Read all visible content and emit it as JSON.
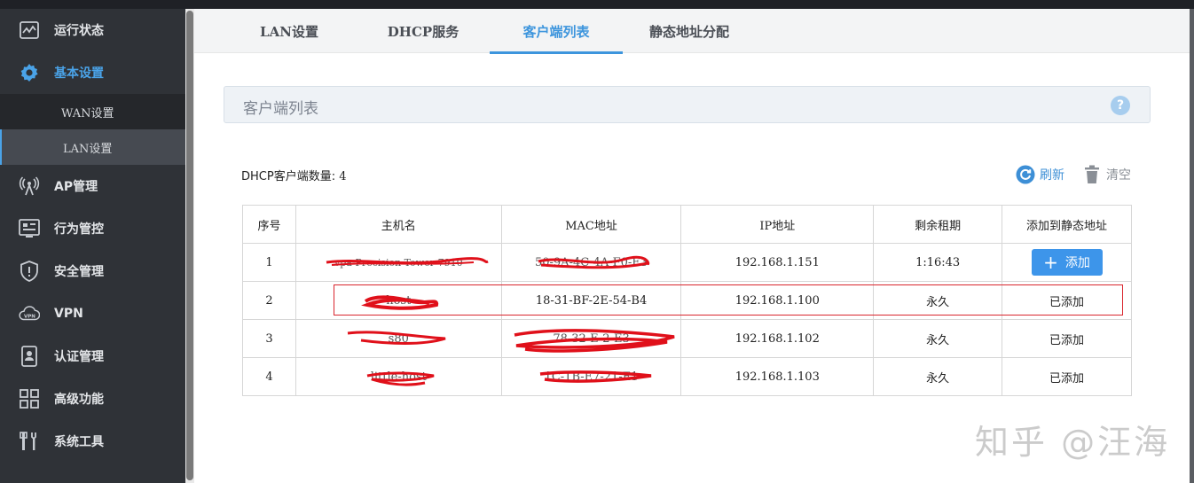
{
  "sidebar": {
    "items": [
      {
        "label": "运行状态",
        "icon": "monitor-chart-icon"
      },
      {
        "label": "基本设置",
        "icon": "gear-icon"
      },
      {
        "label": "AP管理",
        "icon": "antenna-icon"
      },
      {
        "label": "行为管控",
        "icon": "control-panel-icon"
      },
      {
        "label": "安全管理",
        "icon": "shield-icon"
      },
      {
        "label": "VPN",
        "icon": "vpn-cloud-icon"
      },
      {
        "label": "认证管理",
        "icon": "id-badge-icon"
      },
      {
        "label": "高级功能",
        "icon": "grid-apps-icon"
      },
      {
        "label": "系统工具",
        "icon": "tools-icon"
      }
    ],
    "subitems": [
      {
        "label": "WAN设置"
      },
      {
        "label": "LAN设置"
      }
    ]
  },
  "tabs": [
    {
      "label": "LAN设置"
    },
    {
      "label": "DHCP服务"
    },
    {
      "label": "客户端列表"
    },
    {
      "label": "静态地址分配"
    }
  ],
  "panel": {
    "title": "客户端列表",
    "help_glyph": "?"
  },
  "count": {
    "label": "DHCP客户端数量:",
    "value": "4"
  },
  "actions": {
    "refresh": "刷新",
    "clear": "清空"
  },
  "table": {
    "headers": [
      "序号",
      "主机名",
      "MAC地址",
      "IP地址",
      "剩余租期",
      "添加到静态地址"
    ],
    "rows": [
      {
        "index": "1",
        "hostname": "vpa-Precision-Tower-7910",
        "mac": "50-9A-4C-4A-F0-E3",
        "ip": "192.168.1.151",
        "lease": "1:16:43",
        "status": "添加"
      },
      {
        "index": "2",
        "hostname": "host",
        "mac": "18-31-BF-2E-54-B4",
        "ip": "192.168.1.100",
        "lease": "永久",
        "status": "已添加"
      },
      {
        "index": "3",
        "hostname": "s80",
        "mac": "78-32-E-2-E3",
        "ip": "192.168.1.102",
        "lease": "永久",
        "status": "已添加"
      },
      {
        "index": "4",
        "hostname": "little-host",
        "mac": "1C-1B-E7-21-E1",
        "ip": "192.168.1.103",
        "lease": "永久",
        "status": "已添加"
      }
    ]
  },
  "watermark": "知乎 @汪海",
  "colors": {
    "accent": "#3d95dd",
    "sidebar_bg": "#2f3237",
    "highlight_border": "#d9262e",
    "redaction": "#e0101a"
  }
}
